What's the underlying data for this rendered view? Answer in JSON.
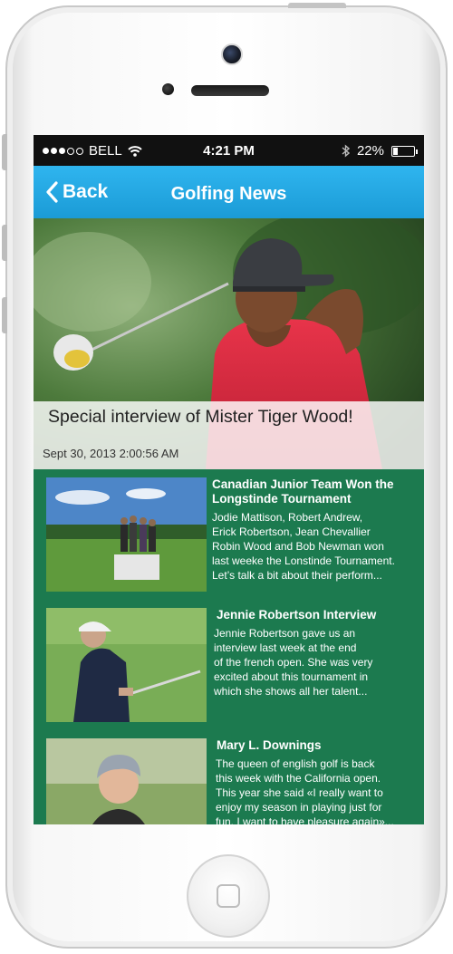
{
  "status_bar": {
    "carrier": "BELL",
    "time": "4:21 PM",
    "battery_percent": "22%",
    "battery_level": 0.22,
    "signal_bars_filled": 3,
    "signal_bars_total": 5
  },
  "nav": {
    "back_label": "Back",
    "title": "Golfing News"
  },
  "featured": {
    "title": "Special interview of Mister Tiger Wood!",
    "date": "Sept 30, 2013 2:00:56 AM"
  },
  "news": [
    {
      "title_lines": [
        "Canadian Junior Team Won the",
        "Longstinde Tournament"
      ],
      "body_lines": [
        "Jodie Mattison, Robert Andrew,",
        "Erick Robertson, Jean Chevallier",
        "Robin Wood and Bob Newman won",
        "last weeke the Lonstinde Tournament.",
        "Let’s talk a bit about their perform..."
      ]
    },
    {
      "title_lines": [
        "Jennie Robertson Interview"
      ],
      "body_lines": [
        "Jennie Robertson gave us an",
        "interview last week at the end",
        "of the french open. She was very",
        "excited about this tournament in",
        "which she shows all her talent..."
      ]
    },
    {
      "title_lines": [
        "Mary L. Downings"
      ],
      "body_lines": [
        "The queen of english golf is back",
        "this week with the California open.",
        "This year she said «I really want to",
        "enjoy my season in playing just for",
        "fun. I want to have pleasure again»..."
      ]
    }
  ],
  "colors": {
    "nav_blue": "#1b9bd6",
    "list_green": "#1c7a4f",
    "status_black": "#111111"
  }
}
